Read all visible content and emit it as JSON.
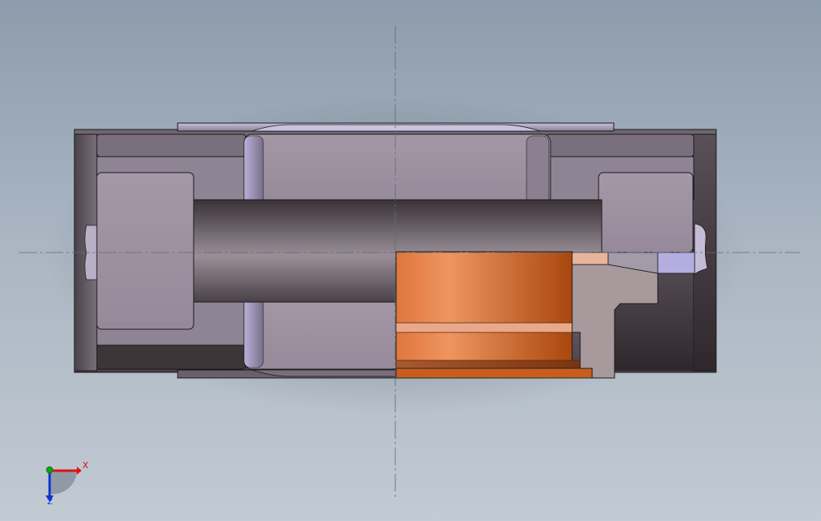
{
  "viewport": {
    "background_top": "#8d9cac",
    "background_bottom": "#c2cad3"
  },
  "triad": {
    "x_label": "X",
    "z_label": "Z",
    "x_color": "#e01010",
    "y_color": "#10a010",
    "z_color": "#1030d0"
  },
  "model": {
    "body_color": "#9e93a2",
    "section_color": "#e07a3a",
    "edge_color": "#1a1a1a"
  }
}
